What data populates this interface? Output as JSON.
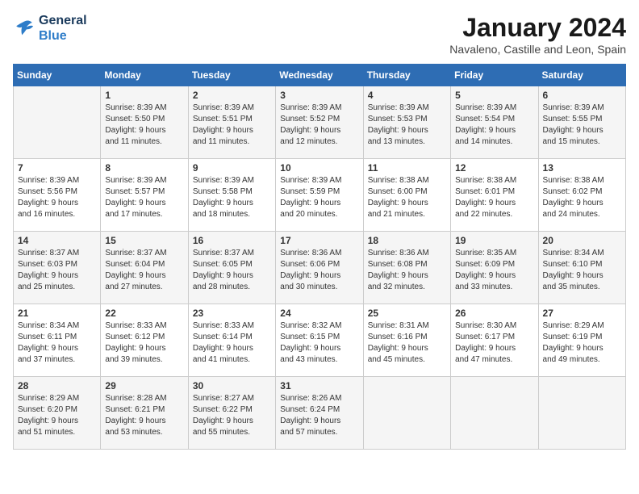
{
  "header": {
    "logo_line1": "General",
    "logo_line2": "Blue",
    "month": "January 2024",
    "location": "Navaleno, Castille and Leon, Spain"
  },
  "days_of_week": [
    "Sunday",
    "Monday",
    "Tuesday",
    "Wednesday",
    "Thursday",
    "Friday",
    "Saturday"
  ],
  "weeks": [
    [
      {
        "day": "",
        "content": ""
      },
      {
        "day": "1",
        "content": "Sunrise: 8:39 AM\nSunset: 5:50 PM\nDaylight: 9 hours\nand 11 minutes."
      },
      {
        "day": "2",
        "content": "Sunrise: 8:39 AM\nSunset: 5:51 PM\nDaylight: 9 hours\nand 11 minutes."
      },
      {
        "day": "3",
        "content": "Sunrise: 8:39 AM\nSunset: 5:52 PM\nDaylight: 9 hours\nand 12 minutes."
      },
      {
        "day": "4",
        "content": "Sunrise: 8:39 AM\nSunset: 5:53 PM\nDaylight: 9 hours\nand 13 minutes."
      },
      {
        "day": "5",
        "content": "Sunrise: 8:39 AM\nSunset: 5:54 PM\nDaylight: 9 hours\nand 14 minutes."
      },
      {
        "day": "6",
        "content": "Sunrise: 8:39 AM\nSunset: 5:55 PM\nDaylight: 9 hours\nand 15 minutes."
      }
    ],
    [
      {
        "day": "7",
        "content": "Sunrise: 8:39 AM\nSunset: 5:56 PM\nDaylight: 9 hours\nand 16 minutes."
      },
      {
        "day": "8",
        "content": "Sunrise: 8:39 AM\nSunset: 5:57 PM\nDaylight: 9 hours\nand 17 minutes."
      },
      {
        "day": "9",
        "content": "Sunrise: 8:39 AM\nSunset: 5:58 PM\nDaylight: 9 hours\nand 18 minutes."
      },
      {
        "day": "10",
        "content": "Sunrise: 8:39 AM\nSunset: 5:59 PM\nDaylight: 9 hours\nand 20 minutes."
      },
      {
        "day": "11",
        "content": "Sunrise: 8:38 AM\nSunset: 6:00 PM\nDaylight: 9 hours\nand 21 minutes."
      },
      {
        "day": "12",
        "content": "Sunrise: 8:38 AM\nSunset: 6:01 PM\nDaylight: 9 hours\nand 22 minutes."
      },
      {
        "day": "13",
        "content": "Sunrise: 8:38 AM\nSunset: 6:02 PM\nDaylight: 9 hours\nand 24 minutes."
      }
    ],
    [
      {
        "day": "14",
        "content": "Sunrise: 8:37 AM\nSunset: 6:03 PM\nDaylight: 9 hours\nand 25 minutes."
      },
      {
        "day": "15",
        "content": "Sunrise: 8:37 AM\nSunset: 6:04 PM\nDaylight: 9 hours\nand 27 minutes."
      },
      {
        "day": "16",
        "content": "Sunrise: 8:37 AM\nSunset: 6:05 PM\nDaylight: 9 hours\nand 28 minutes."
      },
      {
        "day": "17",
        "content": "Sunrise: 8:36 AM\nSunset: 6:06 PM\nDaylight: 9 hours\nand 30 minutes."
      },
      {
        "day": "18",
        "content": "Sunrise: 8:36 AM\nSunset: 6:08 PM\nDaylight: 9 hours\nand 32 minutes."
      },
      {
        "day": "19",
        "content": "Sunrise: 8:35 AM\nSunset: 6:09 PM\nDaylight: 9 hours\nand 33 minutes."
      },
      {
        "day": "20",
        "content": "Sunrise: 8:34 AM\nSunset: 6:10 PM\nDaylight: 9 hours\nand 35 minutes."
      }
    ],
    [
      {
        "day": "21",
        "content": "Sunrise: 8:34 AM\nSunset: 6:11 PM\nDaylight: 9 hours\nand 37 minutes."
      },
      {
        "day": "22",
        "content": "Sunrise: 8:33 AM\nSunset: 6:12 PM\nDaylight: 9 hours\nand 39 minutes."
      },
      {
        "day": "23",
        "content": "Sunrise: 8:33 AM\nSunset: 6:14 PM\nDaylight: 9 hours\nand 41 minutes."
      },
      {
        "day": "24",
        "content": "Sunrise: 8:32 AM\nSunset: 6:15 PM\nDaylight: 9 hours\nand 43 minutes."
      },
      {
        "day": "25",
        "content": "Sunrise: 8:31 AM\nSunset: 6:16 PM\nDaylight: 9 hours\nand 45 minutes."
      },
      {
        "day": "26",
        "content": "Sunrise: 8:30 AM\nSunset: 6:17 PM\nDaylight: 9 hours\nand 47 minutes."
      },
      {
        "day": "27",
        "content": "Sunrise: 8:29 AM\nSunset: 6:19 PM\nDaylight: 9 hours\nand 49 minutes."
      }
    ],
    [
      {
        "day": "28",
        "content": "Sunrise: 8:29 AM\nSunset: 6:20 PM\nDaylight: 9 hours\nand 51 minutes."
      },
      {
        "day": "29",
        "content": "Sunrise: 8:28 AM\nSunset: 6:21 PM\nDaylight: 9 hours\nand 53 minutes."
      },
      {
        "day": "30",
        "content": "Sunrise: 8:27 AM\nSunset: 6:22 PM\nDaylight: 9 hours\nand 55 minutes."
      },
      {
        "day": "31",
        "content": "Sunrise: 8:26 AM\nSunset: 6:24 PM\nDaylight: 9 hours\nand 57 minutes."
      },
      {
        "day": "",
        "content": ""
      },
      {
        "day": "",
        "content": ""
      },
      {
        "day": "",
        "content": ""
      }
    ]
  ]
}
